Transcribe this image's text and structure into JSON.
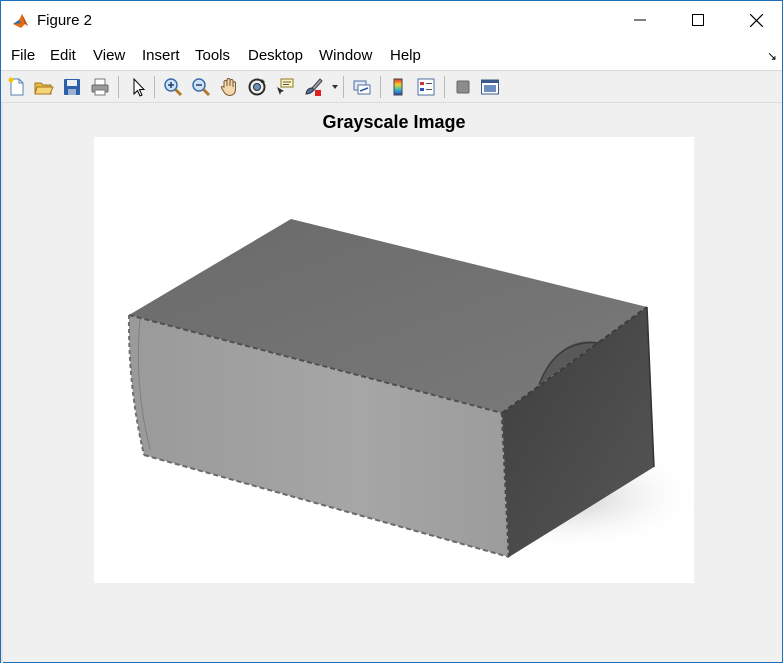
{
  "window": {
    "title": "Figure 2"
  },
  "menu": {
    "items": [
      "File",
      "Edit",
      "View",
      "Insert",
      "Tools",
      "Desktop",
      "Window",
      "Help"
    ]
  },
  "toolbar": {
    "icons": [
      "new-figure-icon",
      "open-file-icon",
      "save-icon",
      "print-icon",
      "edit-plot-arrow-icon",
      "zoom-in-icon",
      "zoom-out-icon",
      "pan-hand-icon",
      "rotate-3d-icon",
      "data-cursor-icon",
      "brush-icon",
      "link-plot-icon",
      "colorbar-icon",
      "legend-icon",
      "hide-plot-tools-icon",
      "show-plot-tools-icon"
    ]
  },
  "axes": {
    "title": "Grayscale Image"
  },
  "image": {
    "subject": "gray cardboard box",
    "colors": {
      "background": "#ffffff",
      "box_top": "#6f6f6f",
      "box_front": "#a2a2a2",
      "box_side": "#4a4a4a"
    }
  },
  "colors": {
    "window_bg": "#f0f0f0",
    "border": "#1e6fb8",
    "accent": "#0060c0"
  }
}
